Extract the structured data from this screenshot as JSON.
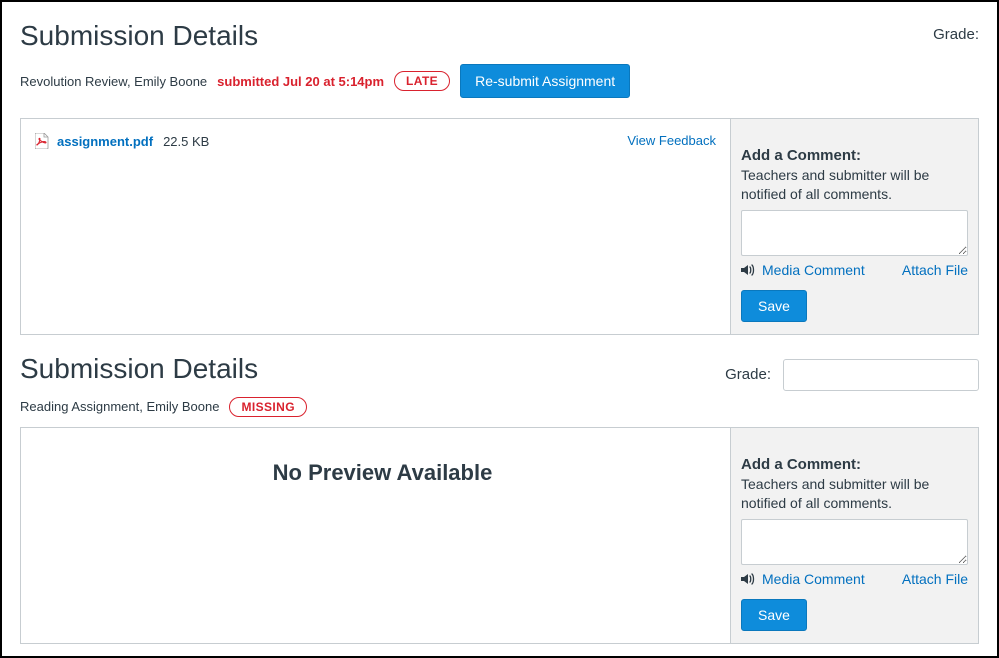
{
  "sections": [
    {
      "title": "Submission Details",
      "assignment_info": "Revolution Review, Emily Boone",
      "submitted_at": "submitted Jul 20 at 5:14pm",
      "status_badge": "LATE",
      "resubmit_label": "Re-submit Assignment",
      "grade_label": "Grade:",
      "file_name": "assignment.pdf",
      "file_size": "22.5 KB",
      "view_feedback": "View Feedback",
      "comment": {
        "title": "Add a Comment:",
        "note": "Teachers and submitter will be notified of all comments.",
        "media_label": "Media Comment",
        "attach_label": "Attach File",
        "save_label": "Save"
      }
    },
    {
      "title": "Submission Details",
      "assignment_info": "Reading Assignment, Emily Boone",
      "status_badge": "MISSING",
      "grade_label": "Grade:",
      "no_preview": "No Preview Available",
      "comment": {
        "title": "Add a Comment:",
        "note": "Teachers and submitter will be notified of all comments.",
        "media_label": "Media Comment",
        "attach_label": "Attach File",
        "save_label": "Save"
      }
    }
  ]
}
